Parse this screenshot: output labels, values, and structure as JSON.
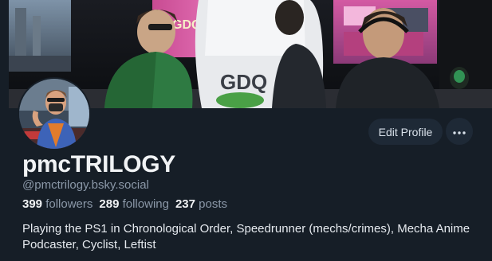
{
  "profile": {
    "display_name": "pmcTRILOGY",
    "handle": "@pmctrilogy.bsky.social",
    "bio": "Playing the PS1 in Chronological Order, Speedrunner (mechs/crimes), Mecha Anime Podcaster, Cyclist, Leftist"
  },
  "stats": {
    "followers_count": "399",
    "followers_label": "followers",
    "following_count": "289",
    "following_label": "following",
    "posts_count": "237",
    "posts_label": "posts"
  },
  "actions": {
    "edit_profile_label": "Edit Profile",
    "more_icon": "ellipsis-icon"
  },
  "banner": {
    "chair_logo_text": "GDQ",
    "screen_logo_text": "GDQ"
  },
  "colors": {
    "background": "#161e27",
    "button_bg": "#1e2936",
    "text_primary": "#f1f3f5",
    "text_secondary": "#8b98a8"
  }
}
